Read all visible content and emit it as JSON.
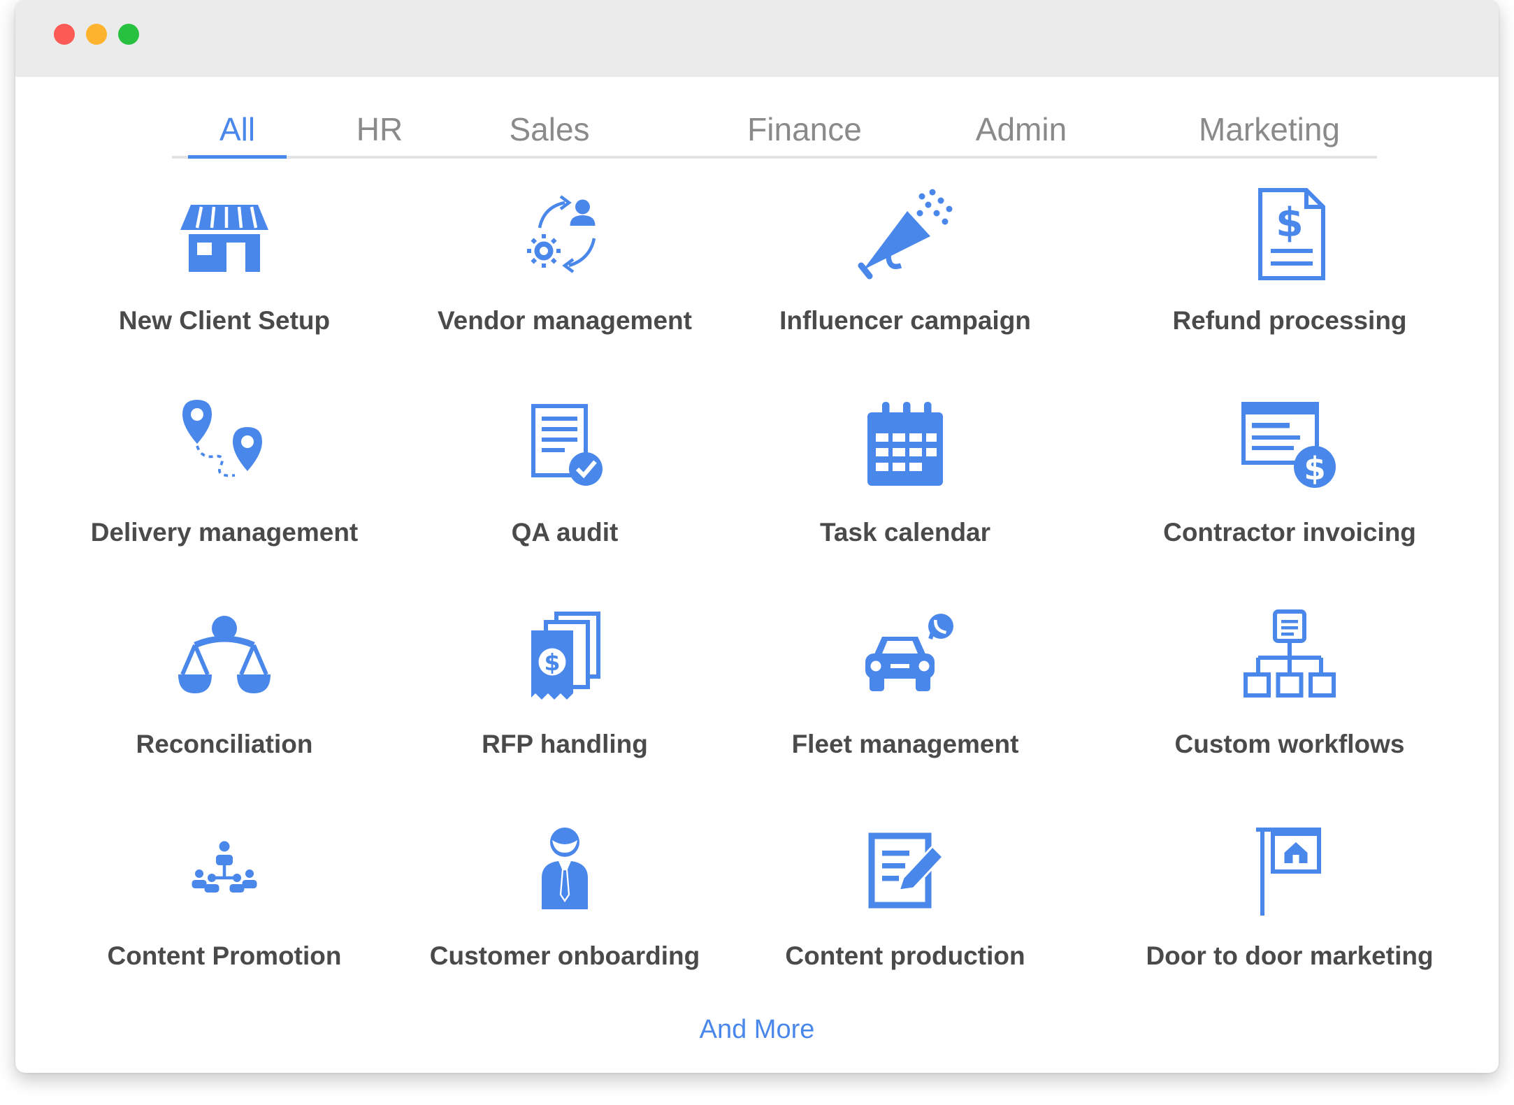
{
  "window": {
    "controls": [
      "close",
      "minimize",
      "maximize"
    ]
  },
  "colors": {
    "accent": "#4a87ea",
    "text": "#4a4a4a",
    "tab_inactive": "#8a8a8a"
  },
  "tabs": [
    {
      "label": "All",
      "active": true
    },
    {
      "label": "HR",
      "active": false
    },
    {
      "label": "Sales",
      "active": false
    },
    {
      "label": "Finance",
      "active": false
    },
    {
      "label": "Admin",
      "active": false
    },
    {
      "label": "Marketing",
      "active": false
    }
  ],
  "tiles": [
    {
      "label": "New Client Setup",
      "icon": "storefront-icon"
    },
    {
      "label": "Vendor management",
      "icon": "vendor-cycle-icon"
    },
    {
      "label": "Influencer campaign",
      "icon": "megaphone-icon"
    },
    {
      "label": "Refund processing",
      "icon": "dollar-document-icon"
    },
    {
      "label": "Delivery management",
      "icon": "route-pins-icon"
    },
    {
      "label": "QA audit",
      "icon": "checked-document-icon"
    },
    {
      "label": "Task calendar",
      "icon": "calendar-icon"
    },
    {
      "label": "Contractor invoicing",
      "icon": "invoice-dollar-icon"
    },
    {
      "label": "Reconciliation",
      "icon": "balance-scale-icon"
    },
    {
      "label": "RFP handling",
      "icon": "stacked-bills-icon"
    },
    {
      "label": "Fleet management",
      "icon": "car-phone-icon"
    },
    {
      "label": "Custom workflows",
      "icon": "workflow-tree-icon"
    },
    {
      "label": "Content Promotion",
      "icon": "people-hierarchy-icon"
    },
    {
      "label": "Customer onboarding",
      "icon": "business-person-icon"
    },
    {
      "label": "Content production",
      "icon": "edit-document-icon"
    },
    {
      "label": "Door to door marketing",
      "icon": "house-sign-icon"
    }
  ],
  "more_link": "And More"
}
